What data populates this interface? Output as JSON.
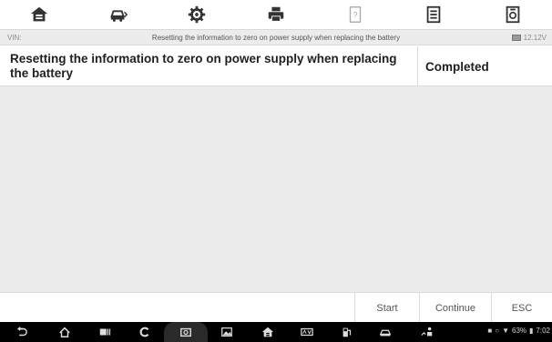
{
  "toolbar": {
    "icons": [
      "home-icon",
      "vehicle-swap-icon",
      "settings-gear-icon",
      "print-icon",
      "help-icon",
      "data-manager-icon",
      "screenshot-icon"
    ]
  },
  "status_bar": {
    "vin_label": "VIN:",
    "title": "Resetting the information to zero on power supply when replacing the battery",
    "voltage": "12.12V"
  },
  "content": {
    "rows": [
      {
        "item": "Resetting the information to zero on power supply when replacing the battery",
        "value": "Completed"
      }
    ]
  },
  "actions": {
    "start": "Start",
    "continue": "Continue",
    "esc": "ESC"
  },
  "system_bar": {
    "battery_pct": "63%",
    "time": "7:02"
  },
  "colors": {
    "toolbar_icon": "#333333",
    "status_bg": "#ececec",
    "action_text": "#555555",
    "nav_bg": "#000000"
  }
}
